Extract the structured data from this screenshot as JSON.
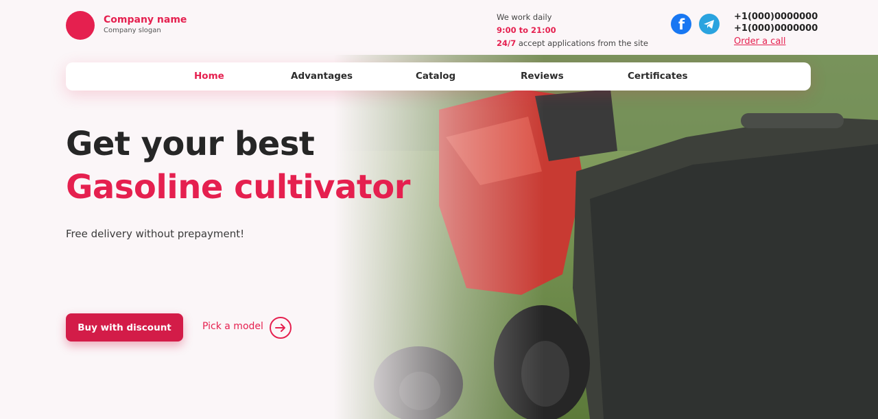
{
  "header": {
    "company_name": "Company name",
    "company_slogan": "Company slogan",
    "work_label": "We work daily",
    "work_time": "9:00 to 21:00",
    "applications_highlight": "24/7",
    "applications_text": " accept applications from the site",
    "phones": [
      "+1(000)0000000",
      "+1(000)0000000"
    ],
    "order_call": "Order a call",
    "social": [
      "facebook-icon",
      "telegram-icon"
    ]
  },
  "nav": {
    "items": [
      "Home",
      "Advantages",
      "Catalog",
      "Reviews",
      "Certificates"
    ],
    "active": "Home"
  },
  "hero": {
    "title_line1": "Get your best",
    "title_line2": "Gasoline cultivator",
    "subtitle": "Free delivery without prepayment!",
    "buy_button": "Buy with discount",
    "pick_link": "Pick a model"
  },
  "colors": {
    "accent": "#e5204f",
    "button": "#d31c48",
    "background": "#fbf6f8"
  }
}
